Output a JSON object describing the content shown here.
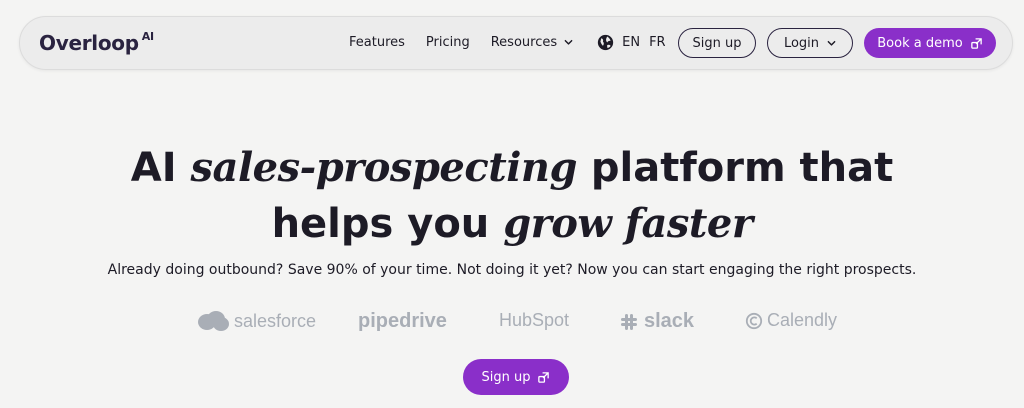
{
  "nav": {
    "logo_text": "Overloop",
    "logo_suffix": "AI",
    "links": [
      "Features",
      "Pricing",
      "Resources"
    ],
    "languages": [
      "EN",
      "FR"
    ],
    "signup_label": "Sign up",
    "login_label": "Login",
    "demo_label": "Book a demo"
  },
  "hero": {
    "line1_a": "AI ",
    "line1_em": "sales-prospecting",
    "line1_b": " platform that",
    "line2_a": "helps you ",
    "line2_em": "grow faster",
    "subtitle": "Already doing outbound? Save 90% of your time. Not doing it yet? Now you can start engaging the right prospects.",
    "cta_label": "Sign up"
  },
  "integrations": {
    "salesforce": "salesforce",
    "pipedrive": "pipedrive",
    "hubspot": "HubSpot",
    "slack": "slack",
    "calendly": "Calendly"
  },
  "colors": {
    "accent": "#8a2fc9",
    "background": "#f4f4f3",
    "logo_gray": "#a9aeb6"
  }
}
